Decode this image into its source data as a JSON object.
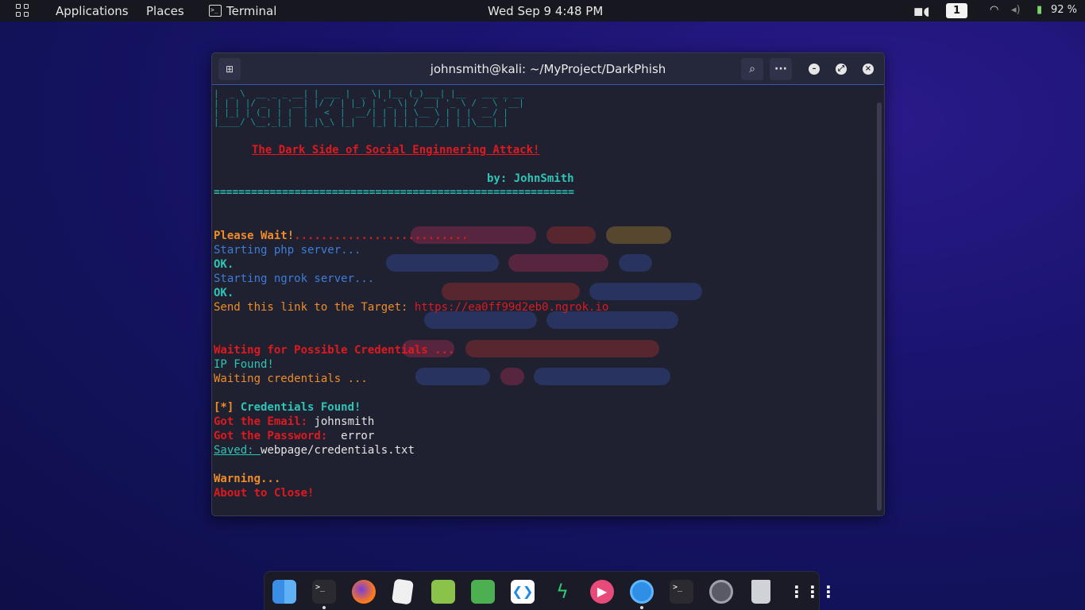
{
  "topbar": {
    "applications": "Applications",
    "places": "Places",
    "terminal": "Terminal",
    "datetime": "Wed Sep 9   4:48 PM",
    "workspace": "1",
    "battery": "92 %"
  },
  "window": {
    "title": "johnsmith@kali: ~/MyProject/DarkPhish",
    "search_icon": "search-icon",
    "menu_icon": "ellipsis-icon"
  },
  "terminal": {
    "banner_ascii_1": "|  _ \\  __ _ _ __| | ___ |  _ \\| |__ (_)___| |__   ___ _ __",
    "banner_ascii_2": "| | | |/ _` | '__| |/ / | |_) | '_ \\| / __| '_ \\ / _ \\ '__|",
    "banner_ascii_3": "| |_| | (_| | |  |   <  |  __/| | | | \\__ \\ | | |  __/ |",
    "banner_ascii_4": "|____/ \\__,_|_|  |_|\\_\\ |_|   |_| |_|_|___/_| |_|\\___|_|",
    "subtitle": "The Dark Side of Social Enginnering Attack!",
    "author": "by: JohnSmith",
    "separator": "==========================================================",
    "please_wait": "Please Wait!",
    "dots": "..........................",
    "php": "Starting php server...",
    "ok1": "OK.",
    "ngrok": "Starting ngrok server...",
    "ok2": "OK.",
    "send_link": "Send this link to the Target: ",
    "url": "https://ea0ff99d2eb0.ngrok.io",
    "waiting_creds": "Waiting for Possible Credentials ...",
    "ip_found": "IP Found!",
    "waiting": "Waiting credentials ...",
    "bracket": "[*]",
    "creds_found": " Credentials Found!",
    "email_label": "Got the Email: ",
    "email_value": "johnsmith",
    "password_label": "Got the Password: ",
    "password_value": " error",
    "saved_label": "Saved: ",
    "saved_value": "webpage/credentials.txt",
    "warning": "Warning...",
    "about_close": "About to Close!"
  },
  "dock": {
    "items": [
      "finder-icon",
      "terminal-icon",
      "firefox-icon",
      "text-editor-icon",
      "spreadsheet-icon",
      "calc-icon",
      "vscode-icon",
      "speed-icon",
      "media-player-icon",
      "chromium-icon",
      "terminal-2-icon",
      "settings-icon",
      "trash-icon",
      "app-grid-icon"
    ]
  },
  "colors": {
    "red": "#e0191e",
    "orange": "#f08c28",
    "cyan": "#2ec4b6",
    "blue": "#3d7dd8"
  }
}
